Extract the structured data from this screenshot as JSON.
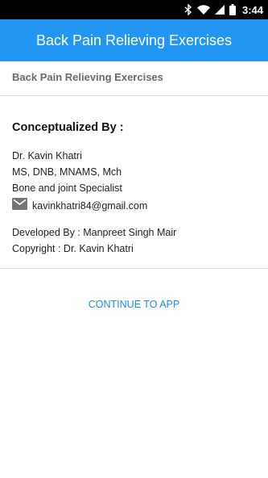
{
  "status_bar": {
    "time": "3:44",
    "icons": [
      "bluetooth-icon",
      "wifi-icon",
      "cell-signal-icon",
      "battery-icon"
    ]
  },
  "app_bar": {
    "title": "Back Pain Relieving Exercises",
    "color": "#2196F3"
  },
  "subtitle": "Back Pain Relieving Exercises",
  "credits": {
    "heading": "Conceptualized By :",
    "name": "Dr. Kavin Khatri",
    "degrees": "MS, DNB, MNAMS, Mch",
    "specialty": "Bone and joint Specialist",
    "email": "kavinkhatri84@gmail.com",
    "developer": "Developed By : Manpreet Singh Mair",
    "copyright": "Copyright : Dr. Kavin Khatri"
  },
  "continue_label": "CONTINUE TO APP",
  "accent_color": "#1a8fe8"
}
